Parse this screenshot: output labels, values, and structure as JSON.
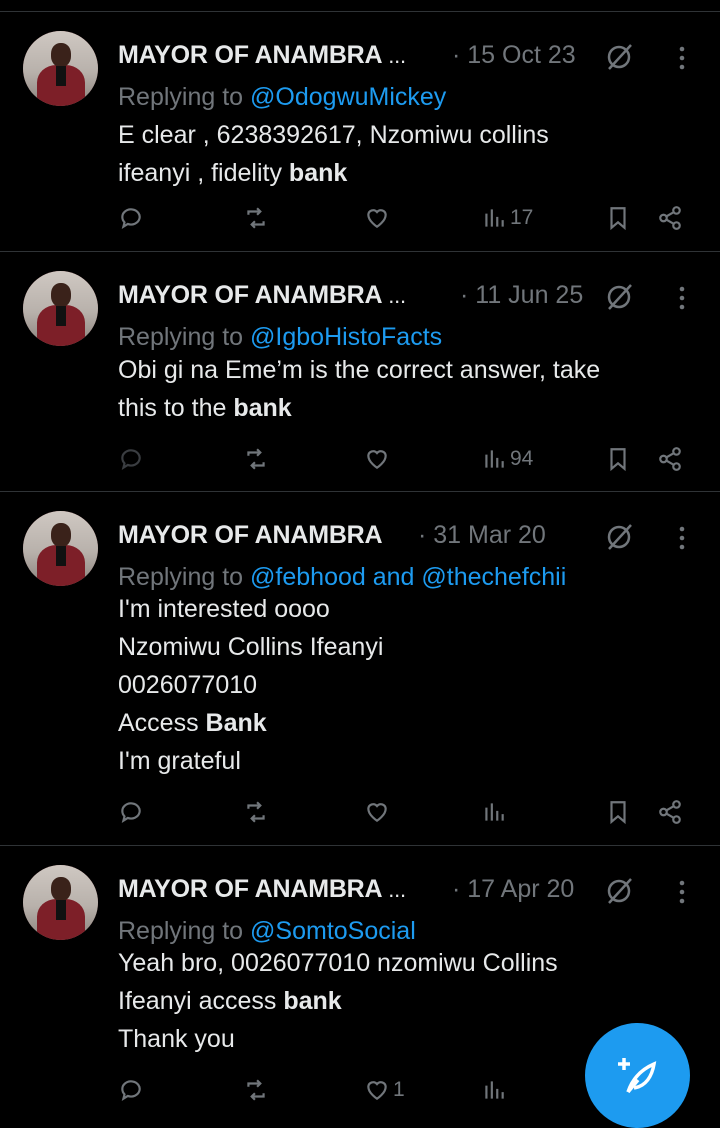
{
  "tweets": [
    {
      "author": "MAYOR OF ANAMBRA",
      "truncated": "...",
      "date": "· 15 Oct 23",
      "replying_prefix": "Replying to ",
      "mentions": "@OdogwuMickey",
      "mentions_joiner": "",
      "mentions2": "",
      "lines": [
        "E clear , 6238392617, Nzomiwu collins",
        "ifeanyi , fidelity "
      ],
      "bold_word": "bank",
      "tail": "",
      "views": "17",
      "likes": ""
    },
    {
      "author": "MAYOR OF ANAMBRA",
      "truncated": "...",
      "date": "· 11 Jun 25",
      "replying_prefix": "Replying to ",
      "mentions": "@IgboHistoFacts",
      "mentions_joiner": "",
      "mentions2": "",
      "lines": [
        "Obi gi na Eme’m is the correct answer, take",
        "this to the "
      ],
      "bold_word": "bank",
      "tail": "",
      "views": "94",
      "likes": ""
    },
    {
      "author": "MAYOR OF ANAMBRA",
      "truncated": "",
      "date": "· 31 Mar 20",
      "replying_prefix": "Replying to ",
      "mentions": "@febhood",
      "mentions_joiner": " and ",
      "mentions2": "@thechefchii",
      "lines": [
        "I'm interested oooo",
        "Nzomiwu Collins Ifeanyi",
        "0026077010",
        "Access "
      ],
      "bold_word": "Bank",
      "tail": "I'm grateful",
      "views": "",
      "likes": ""
    },
    {
      "author": "MAYOR OF ANAMBRA",
      "truncated": "...",
      "date": "· 17 Apr 20",
      "replying_prefix": "Replying to ",
      "mentions": "@SomtoSocial",
      "mentions_joiner": "",
      "mentions2": "",
      "lines": [
        "Yeah bro,  0026077010 nzomiwu Collins",
        "Ifeanyi  access "
      ],
      "bold_word": "bank",
      "tail": "Thank you",
      "views": "",
      "likes": "1"
    }
  ],
  "icons": {
    "reply": "reply-icon",
    "retweet": "retweet-icon",
    "like": "heart-icon",
    "views": "views-icon",
    "bookmark": "bookmark-icon",
    "share": "share-icon",
    "grok": "grok-icon",
    "more": "more-icon",
    "compose": "compose-post-icon"
  },
  "colors": {
    "background": "#000000",
    "text": "#e7e9ea",
    "muted": "#71767b",
    "accent": "#1d9bf0",
    "divider": "#2f3336"
  }
}
